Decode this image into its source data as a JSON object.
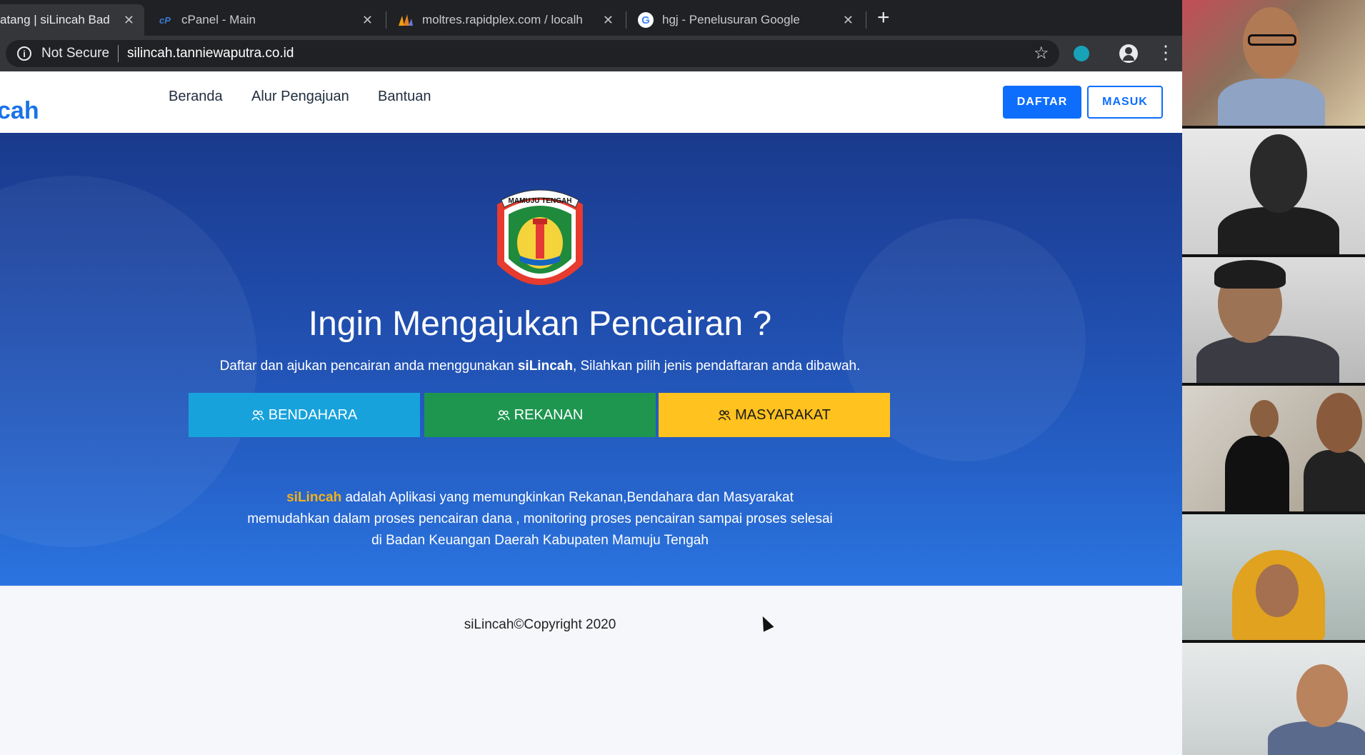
{
  "browser": {
    "tabs": [
      {
        "title": "atang | siLincah Bad",
        "favicon": "silincah-favicon",
        "active": true
      },
      {
        "title": "cPanel - Main",
        "favicon": "cpanel-favicon",
        "active": false
      },
      {
        "title": "moltres.rapidplex.com / localh",
        "favicon": "phpmyadmin-favicon",
        "active": false
      },
      {
        "title": "hgj - Penelusuran Google",
        "favicon": "google-favicon",
        "active": false
      }
    ],
    "security_label": "Not Secure",
    "url": "silincah.tanniewaputra.co.id"
  },
  "site": {
    "brand": "cah",
    "nav": [
      "Beranda",
      "Alur Pengajuan",
      "Bantuan"
    ],
    "daftar_label": "DAFTAR",
    "masuk_label": "MASUK",
    "logo_text": "MAMUJU TENGAH",
    "hero_title": "Ingin Mengajukan Pencairan ?",
    "hero_sub_before": "Daftar dan ajukan pencairan anda menggunakan ",
    "hero_sub_brand": "siLincah",
    "hero_sub_after": ", Silahkan pilih jenis pendaftaran anda dibawah.",
    "buttons": {
      "bendahara": "BENDAHARA",
      "rekanan": "REKANAN",
      "masyarakat": "MASYARAKAT"
    },
    "desc_brand": "siLincah",
    "desc_line1": " adalah Aplikasi yang memungkinkan Rekanan,Bendahara dan Masyarakat",
    "desc_line2": "memudahkan dalam proses pencairan dana , monitoring proses pencairan sampai proses selesai",
    "desc_line3": "di Badan Keuangan Daerah Kabupaten Mamuju Tengah",
    "copyright": "siLincah©Copyright 2020"
  },
  "colors": {
    "bendahara": "#17a2dc",
    "rekanan": "#1e9650",
    "masyarakat": "#ffc21e",
    "primary": "#0d6efd"
  }
}
